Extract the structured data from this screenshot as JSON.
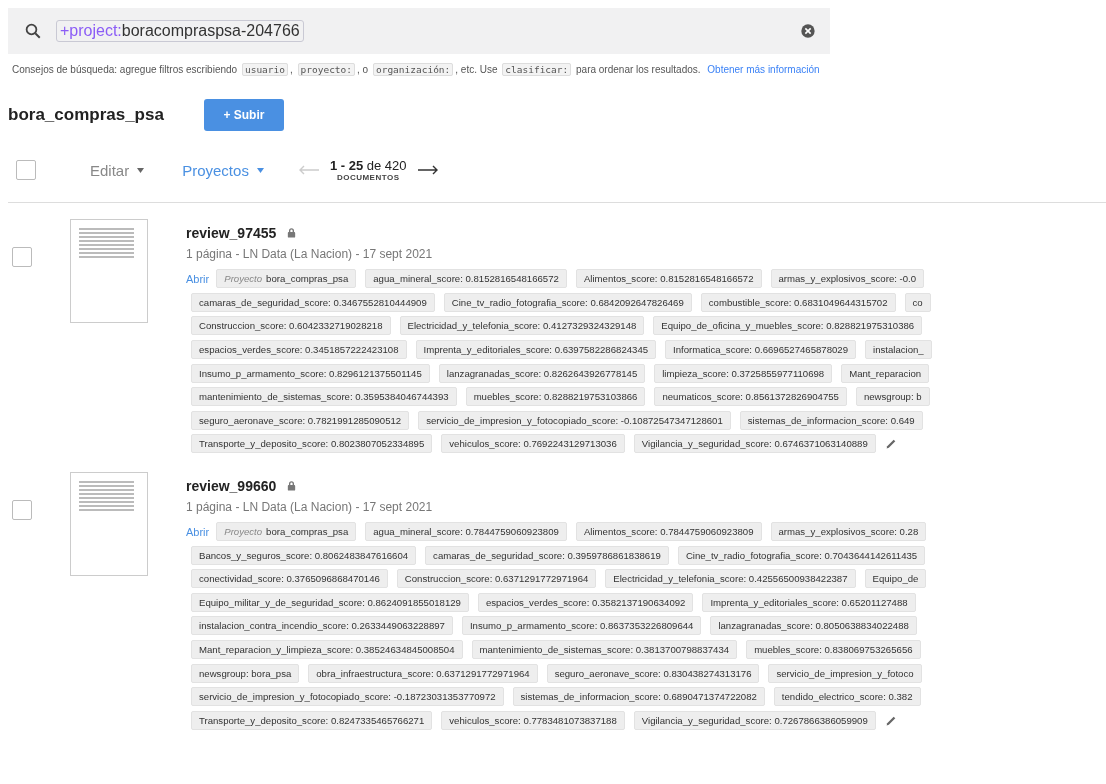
{
  "search": {
    "query_prefix": "+project:",
    "query_value": "boracompraspsa-204766"
  },
  "search_tips": [
    {
      "kind": "text",
      "text": "Consejos de búsqueda: agregue filtros escribiendo"
    },
    {
      "kind": "code",
      "text": "usuario"
    },
    {
      "kind": "text",
      "text": ","
    },
    {
      "kind": "code",
      "text": "proyecto:"
    },
    {
      "kind": "text",
      "text": ", o"
    },
    {
      "kind": "code",
      "text": "organización:"
    },
    {
      "kind": "text",
      "text": ", etc. Use"
    },
    {
      "kind": "code",
      "text": "clasificar:"
    },
    {
      "kind": "text",
      "text": "para ordenar los resultados."
    },
    {
      "kind": "link",
      "text": "Obtener más información"
    }
  ],
  "header": {
    "title": "bora_compras_psa",
    "upload_button": "+ Subir"
  },
  "toolbar": {
    "select_all_checked": false,
    "edit_menu": "Editar",
    "projects_menu": "Proyectos",
    "range": "1 - 25",
    "range_of": "de 420",
    "range_unit": "DOCUMENTOS",
    "prev_disabled": true,
    "next_disabled": false
  },
  "documents": [
    {
      "title": "review_97455",
      "checked": false,
      "meta": "1 página - LN Data (La Nacion) - 17 sept 2021",
      "open_link": "Abrir",
      "project_label": "Proyecto",
      "project_value": "bora_compras_psa",
      "tag_rows": [
        [
          "agua_mineral_score: 0.8152816548166572",
          "Alimentos_score: 0.8152816548166572",
          "armas_y_explosivos_score: -0.0"
        ],
        [
          "camaras_de_seguridad_score: 0.3467552810444909",
          "Cine_tv_radio_fotografia_score: 0.6842092647826469",
          "combustible_score: 0.6831049644315702",
          "co"
        ],
        [
          "Construccion_score: 0.6042332719028218",
          "Electricidad_y_telefonia_score: 0.4127329324329148",
          "Equipo_de_oficina_y_muebles_score: 0.828821975310386"
        ],
        [
          "espacios_verdes_score: 0.3451857222423108",
          "Imprenta_y_editoriales_score: 0.6397582286824345",
          "Informatica_score: 0.6696527465878029",
          "instalacion_"
        ],
        [
          "Insumo_p_armamento_score: 0.8296121375501145",
          "lanzagranadas_score: 0.8262643926778145",
          "limpieza_score: 0.3725855977110698",
          "Mant_reparacion"
        ],
        [
          "mantenimiento_de_sistemas_score: 0.3595384046744393",
          "muebles_score: 0.8288219753103866",
          "neumaticos_score: 0.8561372826904755",
          "newsgroup: b"
        ],
        [
          "seguro_aeronave_score: 0.7821991285090512",
          "servicio_de_impresion_y_fotocopiado_score: -0.10872547347128601",
          "sistemas_de_informacion_score: 0.649"
        ],
        [
          "Transporte_y_deposito_score: 0.8023807052334895",
          "vehiculos_score: 0.7692243129713036",
          "Vigilancia_y_seguridad_score: 0.6746371063140889"
        ]
      ]
    },
    {
      "title": "review_99660",
      "checked": false,
      "meta": "1 página - LN Data (La Nacion) - 17 sept 2021",
      "open_link": "Abrir",
      "project_label": "Proyecto",
      "project_value": "bora_compras_psa",
      "tag_rows": [
        [
          "agua_mineral_score: 0.7844759060923809",
          "Alimentos_score: 0.7844759060923809",
          "armas_y_explosivos_score: 0.28"
        ],
        [
          "Bancos_y_seguros_score: 0.8062483847616604",
          "camaras_de_seguridad_score: 0.3959786861838619",
          "Cine_tv_radio_fotografia_score: 0.7043644142611435"
        ],
        [
          "conectividad_score: 0.3765096868470146",
          "Construccion_score: 0.6371291772971964",
          "Electricidad_y_telefonia_score: 0.42556500938422387",
          "Equipo_de"
        ],
        [
          "Equipo_militar_y_de_seguridad_score: 0.8624091855018129",
          "espacios_verdes_score: 0.3582137190634092",
          "Imprenta_y_editoriales_score: 0.65201127488"
        ],
        [
          "instalacion_contra_incendio_score: 0.2633449063228897",
          "Insumo_p_armamento_score: 0.8637353226809644",
          "lanzagranadas_score: 0.8050638834022488"
        ],
        [
          "Mant_reparacion_y_limpieza_score: 0.38524634845008504",
          "mantenimiento_de_sistemas_score: 0.3813700798837434",
          "muebles_score: 0.838069753265656"
        ],
        [
          "newsgroup: bora_psa",
          "obra_infraestructura_score: 0.6371291772971964",
          "seguro_aeronave_score: 0.830438274313176",
          "servicio_de_impresion_y_fotoco"
        ],
        [
          "servicio_de_impresion_y_fotocopiado_score: -0.18723031353770972",
          "sistemas_de_informacion_score: 0.6890471374722082",
          "tendido_electrico_score: 0.382"
        ],
        [
          "Transporte_y_deposito_score: 0.8247335465766271",
          "vehiculos_score: 0.7783481073837188",
          "Vigilancia_y_seguridad_score: 0.7267866386059909"
        ]
      ]
    }
  ]
}
